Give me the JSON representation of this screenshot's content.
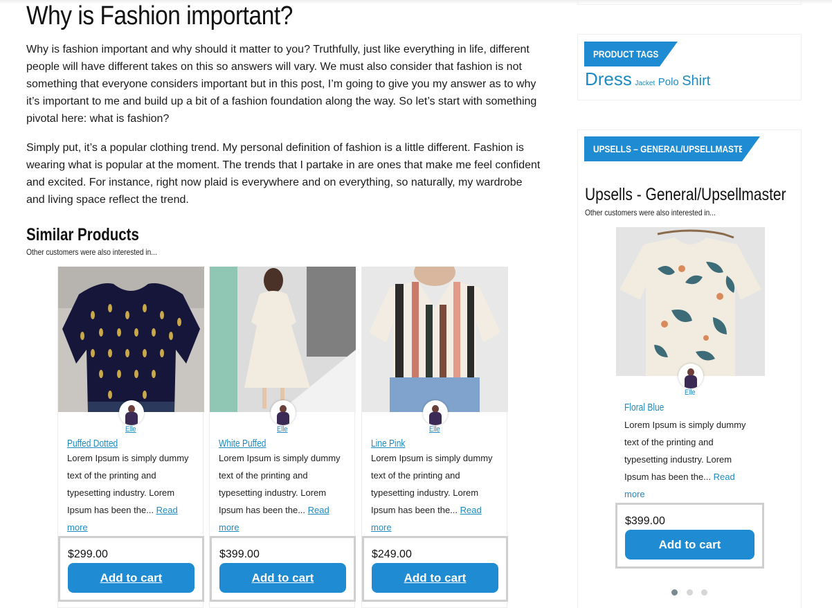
{
  "article": {
    "title": "Why is Fashion important?",
    "paragraph1": "Why is fashion important and why should it matter to you? Truthfully, just like everything in life, different people will have different takes on this so answers will vary. We must also consider that fashion is not something that everyone considers important but in this post, I’m going to give you my answer as to why it’s important to me and build up a bit of a fashion foundation along the way. So let’s start with something pivotal here: what is fashion?",
    "paragraph2": "Simply put, it’s a popular clothing trend. My personal definition of fashion is a little different. Fashion is wearing what is popular at the moment. The trends that I partake in are ones that make me feel confident and excited. For instance, right now plaid is everywhere and on everything, so naturally, my wardrobe and living space reflect the trend."
  },
  "similar": {
    "heading": "Similar Products",
    "subheading": "Other customers were also interested in...",
    "products": [
      {
        "name": "Puffed Dotted",
        "author": "Elle",
        "desc": "Lorem Ipsum is simply dummy text of the printing and typesetting industry. Lorem Ipsum has been the...",
        "read_more": "Read more",
        "price": "$299.00",
        "button": "Add to cart"
      },
      {
        "name": "White Puffed",
        "author": "Elle",
        "desc": "Lorem Ipsum is simply dummy text of the printing and typesetting industry. Lorem Ipsum has been the...",
        "read_more": "Read more",
        "price": "$399.00",
        "button": "Add to cart"
      },
      {
        "name": "Line Pink",
        "author": "Elle",
        "desc": "Lorem Ipsum is simply dummy text of the printing and typesetting industry. Lorem Ipsum has been the...",
        "read_more": "Read more",
        "price": "$249.00",
        "button": "Add to cart"
      }
    ]
  },
  "sidebar": {
    "tags_widget": {
      "banner": "PRODUCT TAGS",
      "tags": [
        "Dress",
        "Jacket",
        "Polo",
        "Shirt"
      ]
    },
    "upsells_widget": {
      "banner": "UPSELLS – GENERAL/UPSELLMASTER",
      "title": "Upsells - General/Upsellmaster",
      "subtitle": "Other customers were also interested in...",
      "product": {
        "name": "Floral Blue",
        "author": "Elle",
        "desc": "Lorem Ipsum is simply dummy text of the printing and typesetting industry. Lorem Ipsum has been the...",
        "read_more": "Read more",
        "price": "$399.00",
        "button": "Add to cart"
      },
      "carousel_dots": 3,
      "active_dot": 1
    }
  },
  "colors": {
    "accent": "#1e8bd3",
    "link": "#1e8bc3",
    "price_border": "#cfcfcf"
  }
}
